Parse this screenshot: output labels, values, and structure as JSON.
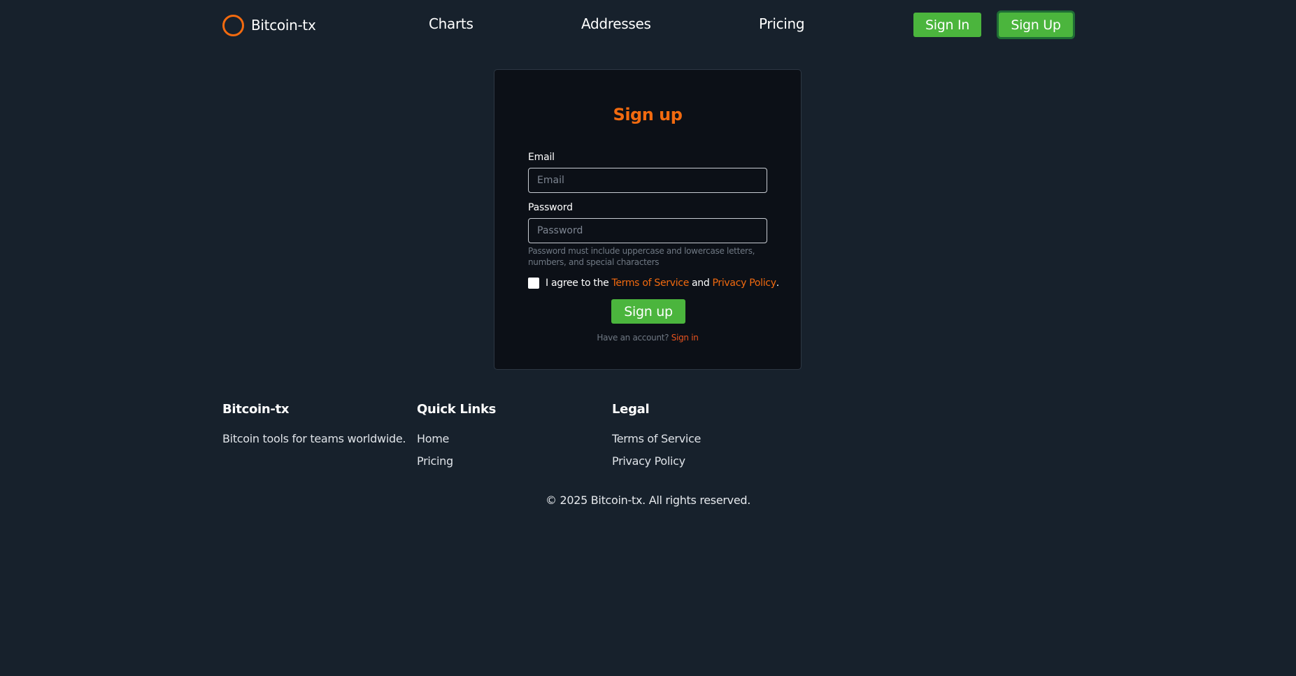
{
  "colors": {
    "background": "#17212c",
    "card_background": "#0c1017",
    "accent_orange": "#f26a0f",
    "button_green": "#4bb53d"
  },
  "header": {
    "logo_icon": "circle-logo-icon",
    "brand": "Bitcoin-tx",
    "nav": [
      "Charts",
      "Addresses",
      "Pricing"
    ],
    "sign_in": "Sign In",
    "sign_up": "Sign Up"
  },
  "form": {
    "title": "Sign up",
    "email_label": "Email",
    "email_placeholder": "Email",
    "email_value": "",
    "password_label": "Password",
    "password_placeholder": "Password",
    "password_value": "",
    "password_hint": "Password must include uppercase and lowercase letters, numbers, and special characters",
    "agree_prefix": "I agree to the",
    "terms_link": "Terms of Service",
    "agree_and": "and",
    "privacy_link": "Privacy Policy",
    "agree_suffix": ".",
    "agree_checked": false,
    "submit": "Sign up",
    "have_account": "Have an account?",
    "sign_in_link": "Sign in"
  },
  "footer": {
    "brand_heading": "Bitcoin-tx",
    "tagline": "Bitcoin tools for teams worldwide.",
    "quick_links_heading": "Quick Links",
    "quick_links": [
      "Home",
      "Pricing"
    ],
    "legal_heading": "Legal",
    "legal_links": [
      "Terms of Service",
      "Privacy Policy"
    ],
    "copyright": "© 2025 Bitcoin-tx. All rights reserved."
  }
}
